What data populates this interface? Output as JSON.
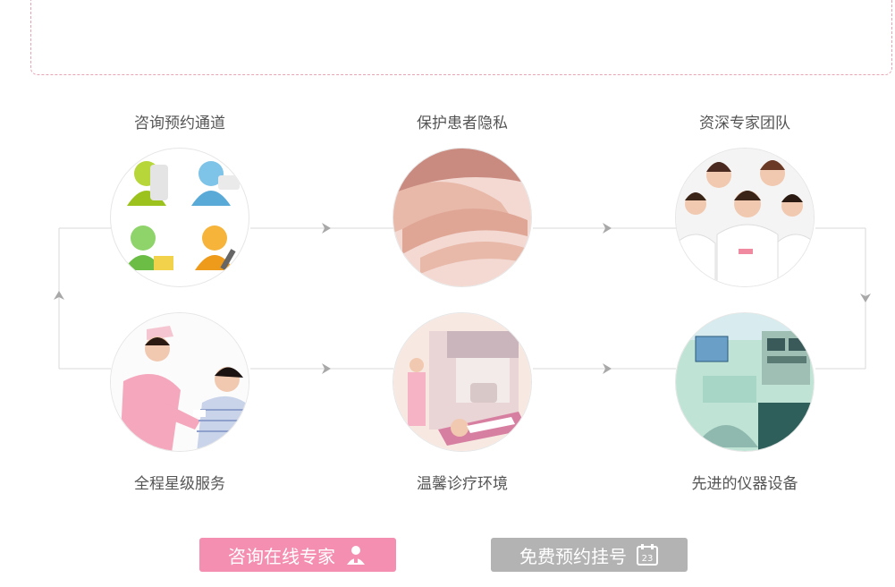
{
  "features": [
    {
      "id": "consult",
      "label": "咨询预约通道",
      "icon": "chat-people-icon"
    },
    {
      "id": "privacy",
      "label": "保护患者隐私",
      "icon": "hands-icon"
    },
    {
      "id": "experts",
      "label": "资深专家团队",
      "icon": "doctors-team-icon"
    },
    {
      "id": "service",
      "label": "全程星级服务",
      "icon": "nurse-patient-icon"
    },
    {
      "id": "environment",
      "label": "温馨诊疗环境",
      "icon": "treatment-room-icon"
    },
    {
      "id": "equipment",
      "label": "先进的仪器设备",
      "icon": "medical-equipment-icon"
    }
  ],
  "buttons": {
    "consult_label": "咨询在线专家",
    "book_label": "免费预约挂号",
    "calendar_day": "23"
  },
  "colors": {
    "pink": "#f48fb1",
    "gray": "#b3b3b3",
    "line": "#d8d8d8"
  }
}
